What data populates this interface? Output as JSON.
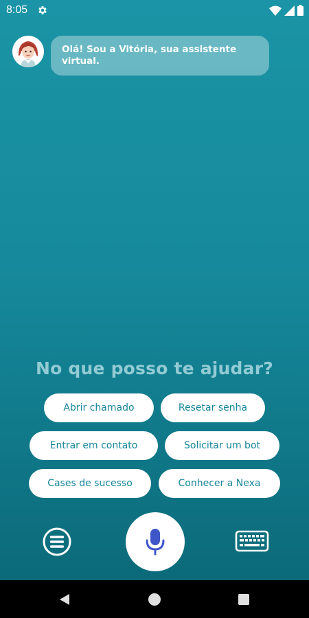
{
  "status_bar": {
    "time": "8:05",
    "icons": [
      "settings-icon",
      "wifi-icon",
      "signal-icon",
      "battery-icon"
    ]
  },
  "chat": {
    "assistant_message": "Olá! Sou a Vitória, sua assistente virtual."
  },
  "prompt": "No que posso te ajudar?",
  "quick_replies": [
    "Abrir chamado",
    "Resetar senha",
    "Entrar em contato",
    "Solicitar um bot",
    "Cases de sucesso",
    "Conhecer a Nexa"
  ],
  "controls": {
    "left_icon": "menu-icon",
    "center_icon": "microphone-icon",
    "right_icon": "keyboard-icon"
  },
  "colors": {
    "background_top": "#1a94a6",
    "background_bottom": "#0c6a79",
    "accent": "#17869a",
    "mic": "#3f56c8"
  }
}
